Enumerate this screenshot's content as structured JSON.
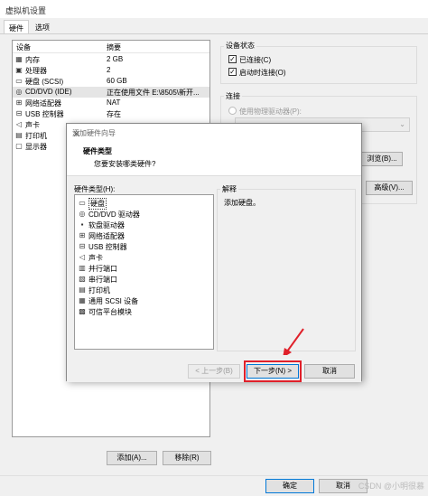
{
  "window": {
    "title": "虚拟机设置"
  },
  "tabs": [
    {
      "label": "硬件"
    },
    {
      "label": "选项"
    }
  ],
  "device_list": {
    "col_device": "设备",
    "col_summary": "摘要",
    "rows": [
      {
        "icon": "memory-icon",
        "name": "内存",
        "summary": "2 GB"
      },
      {
        "icon": "cpu-icon",
        "name": "处理器",
        "summary": "2"
      },
      {
        "icon": "harddisk-icon",
        "name": "硬盘 (SCSI)",
        "summary": "60 GB"
      },
      {
        "icon": "cdrom-icon",
        "name": "CD/DVD (IDE)",
        "summary": "正在使用文件 E:\\8505\\新开..."
      },
      {
        "icon": "network-icon",
        "name": "网络适配器",
        "summary": "NAT"
      },
      {
        "icon": "usb-icon",
        "name": "USB 控制器",
        "summary": "存在"
      },
      {
        "icon": "sound-icon",
        "name": "声卡",
        "summary": ""
      },
      {
        "icon": "printer-icon",
        "name": "打印机",
        "summary": ""
      },
      {
        "icon": "display-icon",
        "name": "显示器",
        "summary": ""
      }
    ]
  },
  "device_status": {
    "title": "设备状态",
    "connected": "已连接(C)",
    "connect_on_start": "启动时连接(O)"
  },
  "connection": {
    "title": "连接",
    "use_physical": "使用物理驱动器(P):",
    "browse": "浏览(B)...",
    "advanced": "高级(V)..."
  },
  "bottom_buttons": {
    "add": "添加(A)...",
    "remove": "移除(R)",
    "ok": "确定",
    "cancel": "取消"
  },
  "wizard": {
    "title": "添加硬件向导",
    "header_title": "硬件类型",
    "header_sub": "您要安装哪类硬件?",
    "list_label": "硬件类型(H):",
    "explain_label": "解释",
    "explain_text": "添加硬盘。",
    "items": [
      {
        "icon": "harddisk-icon",
        "name": "硬盘"
      },
      {
        "icon": "cdrom-icon",
        "name": "CD/DVD 驱动器"
      },
      {
        "icon": "floppy-icon",
        "name": "软盘驱动器"
      },
      {
        "icon": "network-icon",
        "name": "网络适配器"
      },
      {
        "icon": "usb-icon",
        "name": "USB 控制器"
      },
      {
        "icon": "sound-icon",
        "name": "声卡"
      },
      {
        "icon": "parallel-port-icon",
        "name": "并行端口"
      },
      {
        "icon": "serial-port-icon",
        "name": "串行端口"
      },
      {
        "icon": "printer-icon",
        "name": "打印机"
      },
      {
        "icon": "scsi-icon",
        "name": "通用 SCSI 设备"
      },
      {
        "icon": "tpm-icon",
        "name": "可信平台模块"
      }
    ],
    "back": "< 上一步(B)",
    "next": "下一步(N) >",
    "cancel": "取消"
  },
  "watermark": "CSDN @小明很慕"
}
